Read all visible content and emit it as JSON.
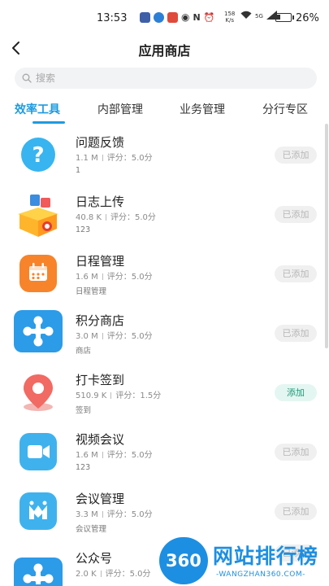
{
  "status_bar": {
    "time": "13:53",
    "net_speed": "158",
    "net_unit": "K/s",
    "signal": "5G",
    "battery": "26%",
    "battery_level": 0.26
  },
  "header": {
    "title": "应用商店"
  },
  "search": {
    "placeholder": "搜索"
  },
  "tabs": [
    {
      "label": "效率工具",
      "active": true
    },
    {
      "label": "内部管理",
      "active": false
    },
    {
      "label": "业务管理",
      "active": false
    },
    {
      "label": "分行专区",
      "active": false
    }
  ],
  "apps": [
    {
      "name": "问题反馈",
      "size": "1.1 M",
      "rating": "评分：5.0分",
      "desc": "1",
      "button": "已添加",
      "added": true,
      "icon": "question-icon"
    },
    {
      "name": "日志上传",
      "size": "40.8 K",
      "rating": "评分：5.0分",
      "desc": "123",
      "button": "已添加",
      "added": true,
      "icon": "gift-box-icon"
    },
    {
      "name": "日程管理",
      "size": "1.6 M",
      "rating": "评分：5.0分",
      "desc": "日程管理",
      "button": "已添加",
      "added": true,
      "icon": "calendar-icon"
    },
    {
      "name": "积分商店",
      "size": "3.0 M",
      "rating": "评分：5.0分",
      "desc": "商店",
      "button": "已添加",
      "added": true,
      "icon": "network-icon"
    },
    {
      "name": "打卡签到",
      "size": "510.9 K",
      "rating": "评分：1.5分",
      "desc": "签到",
      "button": "添加",
      "added": false,
      "icon": "location-pin-icon"
    },
    {
      "name": "视频会议",
      "size": "1.6 M",
      "rating": "评分：5.0分",
      "desc": "123",
      "button": "已添加",
      "added": true,
      "icon": "video-camera-icon"
    },
    {
      "name": "会议管理",
      "size": "3.3 M",
      "rating": "评分：5.0分",
      "desc": "会议管理",
      "button": "已添加",
      "added": true,
      "icon": "meeting-icon"
    },
    {
      "name": "公众号",
      "size": "2.0 K",
      "rating": "评分：5.0分",
      "desc": "",
      "button": "已添加",
      "added": true,
      "icon": "network-icon"
    }
  ],
  "watermark": {
    "badge": "360",
    "title": "网站排行榜",
    "url": "-WANGZHAN360.COM-"
  },
  "colors": {
    "accent": "#1e9be0",
    "add_button_text": "#1a9a78",
    "added_button_text": "#b6b6b6"
  }
}
